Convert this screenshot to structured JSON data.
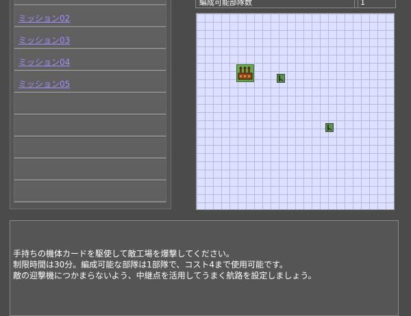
{
  "missions": [
    {
      "label": "ミッション02"
    },
    {
      "label": "ミッション03"
    },
    {
      "label": "ミッション04"
    },
    {
      "label": "ミッション05"
    }
  ],
  "info": {
    "label": "編成可能部隊数",
    "value": "1"
  },
  "map": {
    "markers": [
      {
        "type": "factory-icon"
      },
      {
        "type": "fighter-icon"
      },
      {
        "type": "fighter-icon"
      }
    ]
  },
  "briefing": {
    "lines": [
      "手持ちの機体カードを駆使して敵工場を爆撃してください。",
      "制限時間は30分。編成可能な部隊は1部隊で、コスト4まで使用可能です。",
      "敵の迎撃機につかまらないよう、中継点を活用してうまく航路を設定しましょう。"
    ]
  },
  "colors": {
    "background": "#4b4b4b",
    "panel": "#555555",
    "link": "#a98bff",
    "grid": "#dde1ff"
  }
}
